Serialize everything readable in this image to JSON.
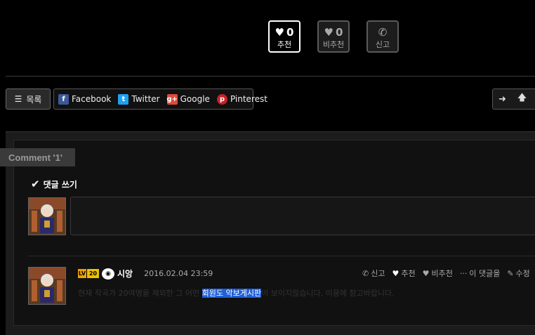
{
  "votes": [
    {
      "count": "0",
      "label": "추천",
      "icon": "heart-icon"
    },
    {
      "count": "0",
      "label": "비추천",
      "icon": "heart-icon"
    },
    {
      "label": "신고",
      "icon": "phone-icon"
    }
  ],
  "toolbar": {
    "list_label": "목록",
    "share": [
      {
        "label": "Facebook",
        "icon": "facebook-icon",
        "color": "#3b5998",
        "glyph": "f"
      },
      {
        "label": "Twitter",
        "icon": "twitter-icon",
        "color": "#1da1f2",
        "glyph": "t"
      },
      {
        "label": "Google",
        "icon": "google-plus-icon",
        "color": "#dd4b39",
        "glyph": "g+"
      },
      {
        "label": "Pinterest",
        "icon": "pinterest-icon",
        "color": "#cb2027",
        "glyph": "p"
      }
    ]
  },
  "comments": {
    "tab_label": "Comment '1'",
    "write_title": "댓글 쓰기",
    "items": [
      {
        "level_prefix": "LV",
        "level": "20",
        "author": "시앙",
        "date": "2016.02.04 23:59",
        "actions": [
          "신고",
          "추천",
          "비추천",
          "이 댓글을",
          "수정"
        ],
        "text_before": "현재 작곡가 20여명을 제외한 그 어떤 ",
        "text_highlight": "회원도 악보게시판",
        "text_after": "이 보이지않습니다. 이용에 참고바랍니다."
      }
    ]
  }
}
